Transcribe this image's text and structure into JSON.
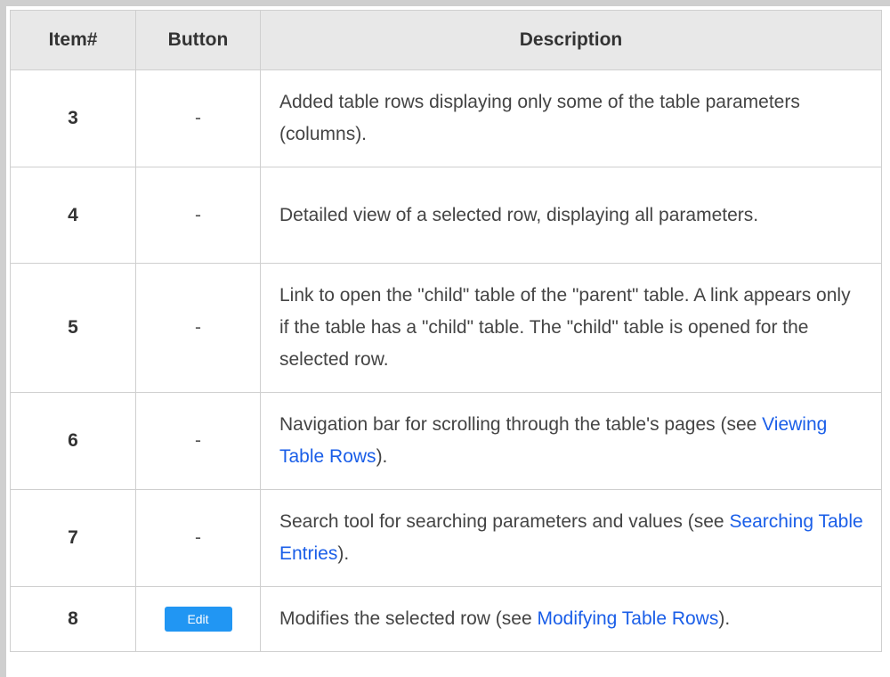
{
  "header": {
    "item": "Item#",
    "button": "Button",
    "description": "Description"
  },
  "rows": [
    {
      "item": "3",
      "button": "-",
      "description": "Added table rows displaying only some of the table parameters (columns)."
    },
    {
      "item": "4",
      "button": "-",
      "description": "Detailed view of a selected row, displaying all parameters."
    },
    {
      "item": "5",
      "button": "-",
      "description": "Link to open the \"child\" table of the \"parent\" table. A link appears only if the table has a \"child\" table. The \"child\" table is opened for the selected row."
    },
    {
      "item": "6",
      "button": "-",
      "desc_pre": "Navigation bar for scrolling through the table's pages (see ",
      "link": "Viewing Table Rows",
      "desc_post": ")."
    },
    {
      "item": "7",
      "button": "-",
      "desc_pre": "Search tool for searching parameters and values (see ",
      "link": "Searching Table Entries",
      "desc_post": ")."
    },
    {
      "item": "8",
      "button_label": "Edit",
      "desc_pre": "Modifies the selected row (see ",
      "link": "Modifying Table Rows",
      "desc_post": ")."
    }
  ],
  "colors": {
    "header_bg": "#e8e8e8",
    "border": "#cfcfcf",
    "link": "#1a5ee8",
    "edit_button": "#2196f3"
  }
}
